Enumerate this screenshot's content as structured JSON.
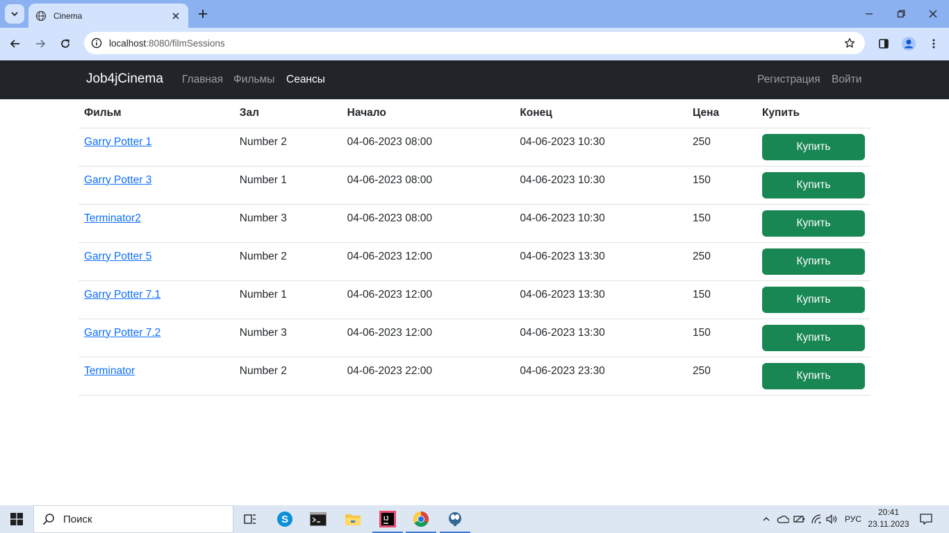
{
  "browser": {
    "tab_title": "Cinema",
    "url_host": "localhost",
    "url_path": ":8080/filmSessions"
  },
  "navbar": {
    "brand": "Job4jCinema",
    "links": [
      "Главная",
      "Фильмы",
      "Сеансы"
    ],
    "active_link": "Сеансы",
    "auth_links": [
      "Регистрация",
      "Войти"
    ]
  },
  "table": {
    "headers": [
      "Фильм",
      "Зал",
      "Начало",
      "Конец",
      "Цена",
      "Купить"
    ],
    "rows": [
      {
        "film": "Garry Potter 1",
        "hall": "Number 2",
        "start": "04-06-2023 08:00",
        "end": "04-06-2023 10:30",
        "price": "250",
        "buy_label": "Купить"
      },
      {
        "film": "Garry Potter 3",
        "hall": "Number 1",
        "start": "04-06-2023 08:00",
        "end": "04-06-2023 10:30",
        "price": "150",
        "buy_label": "Купить"
      },
      {
        "film": "Terminator2",
        "hall": "Number 3",
        "start": "04-06-2023 08:00",
        "end": "04-06-2023 10:30",
        "price": "150",
        "buy_label": "Купить"
      },
      {
        "film": "Garry Potter 5",
        "hall": "Number 2",
        "start": "04-06-2023 12:00",
        "end": "04-06-2023 13:30",
        "price": "250",
        "buy_label": "Купить"
      },
      {
        "film": "Garry Potter 7.1",
        "hall": "Number 1",
        "start": "04-06-2023 12:00",
        "end": "04-06-2023 13:30",
        "price": "150",
        "buy_label": "Купить"
      },
      {
        "film": "Garry Potter 7.2",
        "hall": "Number 3",
        "start": "04-06-2023 12:00",
        "end": "04-06-2023 13:30",
        "price": "150",
        "buy_label": "Купить"
      },
      {
        "film": "Terminator",
        "hall": "Number 2",
        "start": "04-06-2023 22:00",
        "end": "04-06-2023 23:30",
        "price": "250",
        "buy_label": "Купить"
      }
    ]
  },
  "taskbar": {
    "search_label": "Поиск",
    "lang": "РУС",
    "time": "20:41",
    "date": "23.11.2023",
    "pinned_icons": [
      "task-view-icon",
      "skype-icon",
      "terminal-icon",
      "file-explorer-icon",
      "intellij-icon",
      "chrome-icon",
      "postgres-icon"
    ]
  },
  "colors": {
    "navbar_bg": "#212529",
    "buy_button": "#198754",
    "link": "#0d6efd",
    "tabbar": "#8bb1f0",
    "toolbar": "#d3e3fd"
  }
}
